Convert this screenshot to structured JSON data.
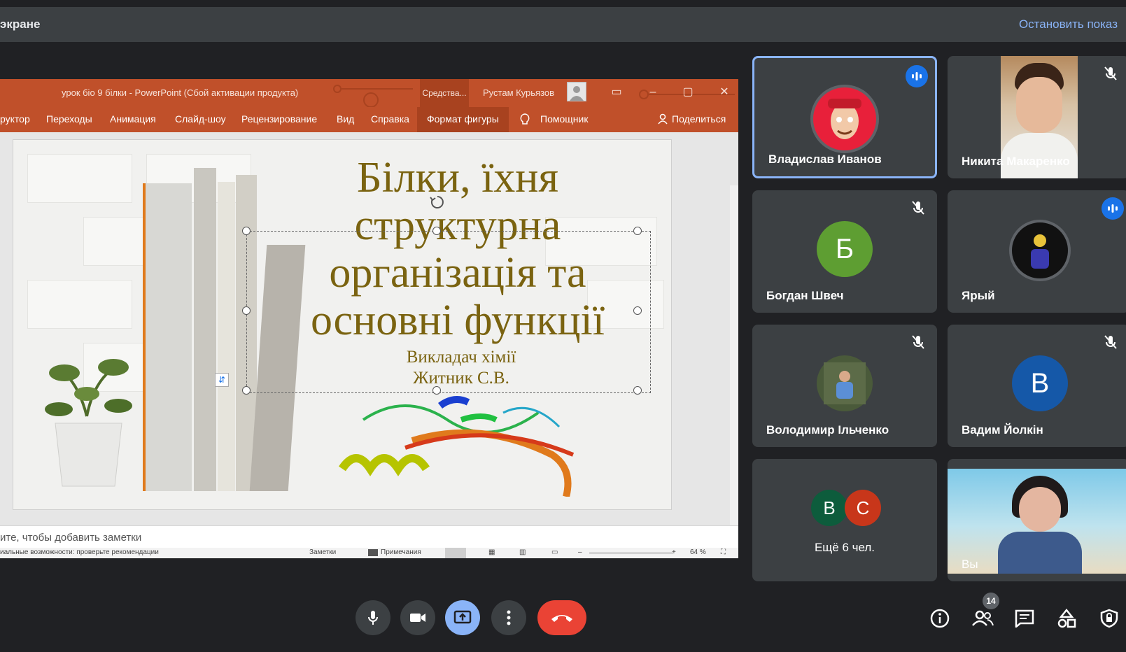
{
  "banner": {
    "title": "экране",
    "stop_label": "Остановить показ"
  },
  "ppt": {
    "doc_title": "урок біо 9 білки  -  PowerPoint (Сбой активации продукта)",
    "tools_label": "Средства...",
    "user_name": "Рустам Курьязов",
    "menu": {
      "m0": "руктор",
      "m1": "Переходы",
      "m2": "Анимация",
      "m3": "Слайд-шоу",
      "m4": "Рецензирование",
      "m5": "Вид",
      "m6": "Справка",
      "m7": "Формат фигуры",
      "m8": "Помощник",
      "m9": "Поделиться"
    },
    "slide": {
      "title_l1": "Білки, їхня",
      "title_l2": "структурна",
      "title_l3": "організація та",
      "title_l4": "основні функції",
      "sub_l1": "Викладач хімії",
      "sub_l2": "Житник С.В."
    },
    "notes_placeholder": "ите, чтобы добавить заметки",
    "status": {
      "accessibility": "иальные возможности: проверьте рекомендации",
      "notes": "Заметки",
      "comments": "Примечания",
      "zoom": "64 %"
    }
  },
  "participants": {
    "p1": {
      "name": "Владислав Иванов"
    },
    "p2": {
      "name": "Никита Макаренко"
    },
    "p3": {
      "name": "Богдан Швеч",
      "initial": "Б"
    },
    "p4": {
      "name": "Ярый"
    },
    "p5": {
      "name": "Володимир Ільченко"
    },
    "p6": {
      "name": "Вадим Йолкін",
      "initial": "В"
    },
    "p7": {
      "name": "Ещё 6 чел.",
      "initial_a": "В",
      "initial_b": "С"
    },
    "p8": {
      "name": "Вы"
    }
  },
  "controls": {
    "people_count": "14"
  },
  "colors": {
    "banner_bg": "#3c4043",
    "accent": "#8ab4f8",
    "ppt_ribbon": "#c0502a",
    "end_call": "#ea4335",
    "slide_text": "#7a6310"
  }
}
